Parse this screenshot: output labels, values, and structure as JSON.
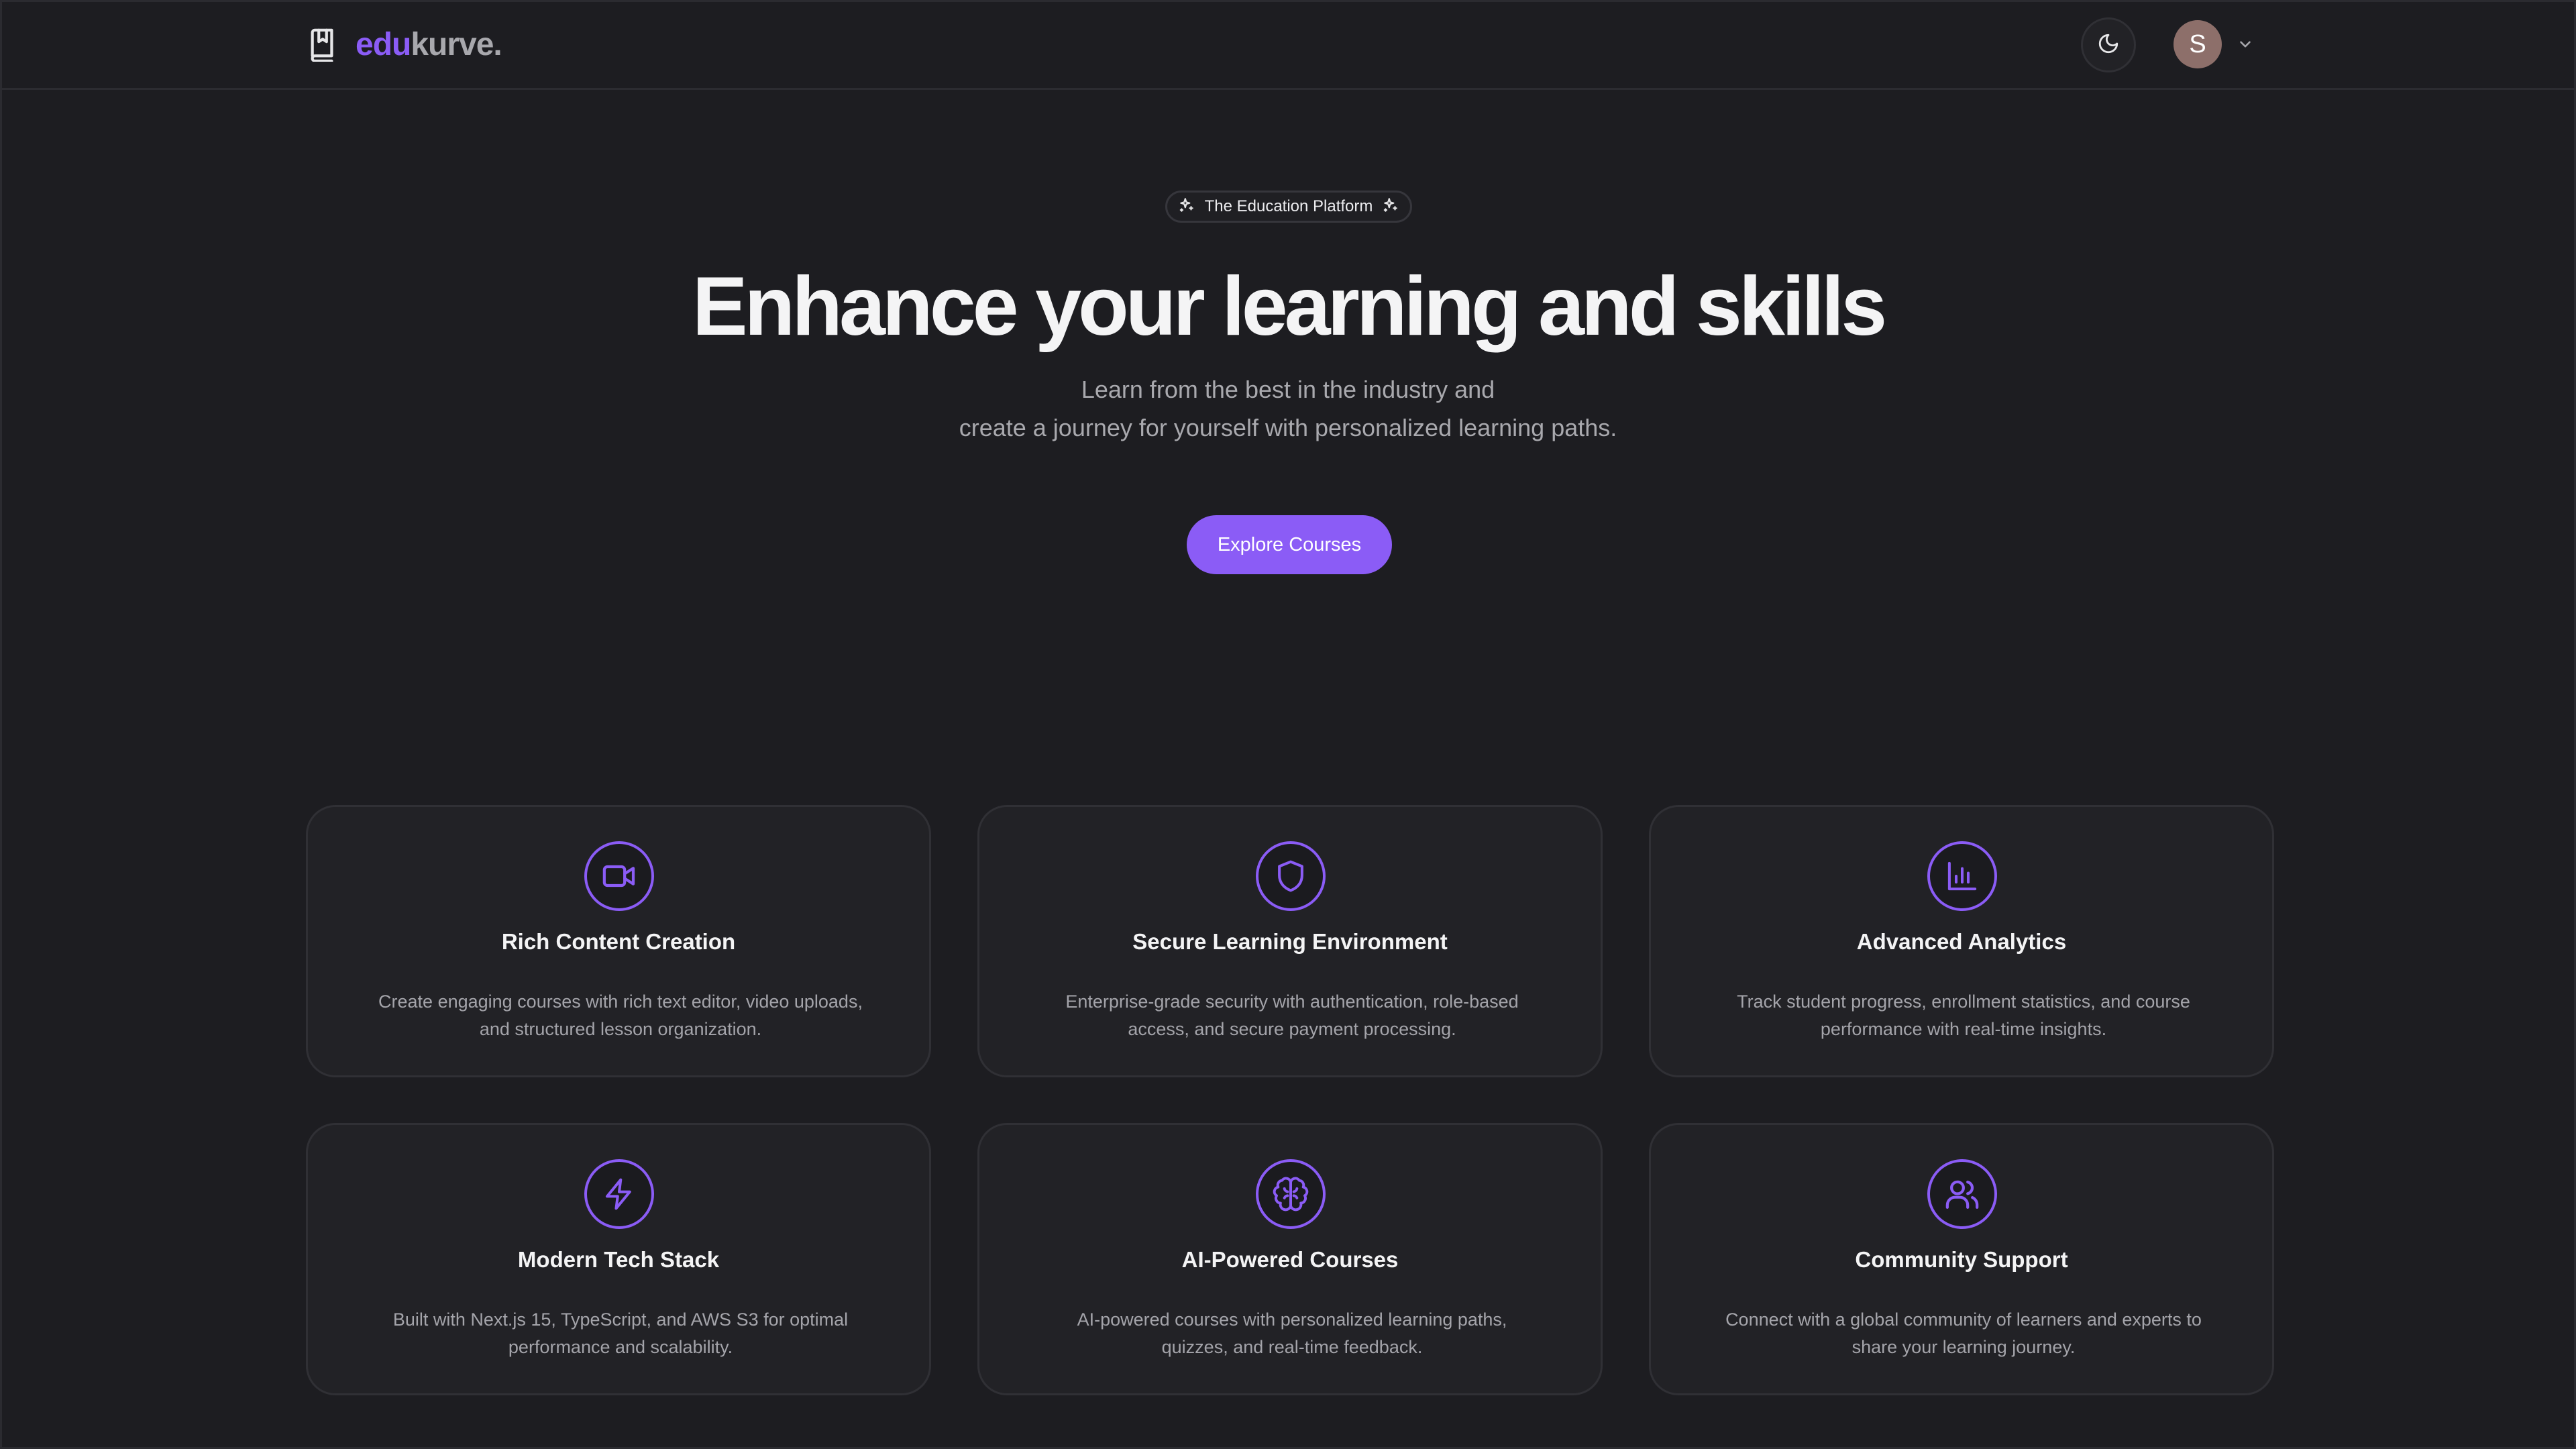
{
  "brand": {
    "prefix": "edu",
    "suffix": "kurve.",
    "accent_color": "#8b5cf6"
  },
  "header": {
    "theme_toggle_icon": "moon-icon",
    "user_initial": "S",
    "menu_icon": "chevron-down-icon"
  },
  "hero": {
    "badge": "The Education Platform",
    "badge_icon": "sparkles-icon",
    "title": "Enhance your learning and skills",
    "subtitle_line1": "Learn from the best in the industry and",
    "subtitle_line2": "create a journey for yourself with personalized learning paths.",
    "cta_label": "Explore Courses"
  },
  "features": [
    {
      "icon": "video-icon",
      "title": "Rich Content Creation",
      "description": "Create engaging courses with rich text editor, video uploads, and structured lesson organization."
    },
    {
      "icon": "shield-icon",
      "title": "Secure Learning Environment",
      "description": "Enterprise-grade security with authentication, role-based access, and secure payment processing."
    },
    {
      "icon": "bar-chart-icon",
      "title": "Advanced Analytics",
      "description": "Track student progress, enrollment statistics, and course performance with real-time insights."
    },
    {
      "icon": "lightning-icon",
      "title": "Modern Tech Stack",
      "description": "Built with Next.js 15, TypeScript, and AWS S3 for optimal performance and scalability."
    },
    {
      "icon": "brain-icon",
      "title": "AI-Powered Courses",
      "description": "AI-powered courses with personalized learning paths, quizzes, and real-time feedback."
    },
    {
      "icon": "users-icon",
      "title": "Community Support",
      "description": "Connect with a global community of learners and experts to share your learning journey."
    }
  ]
}
